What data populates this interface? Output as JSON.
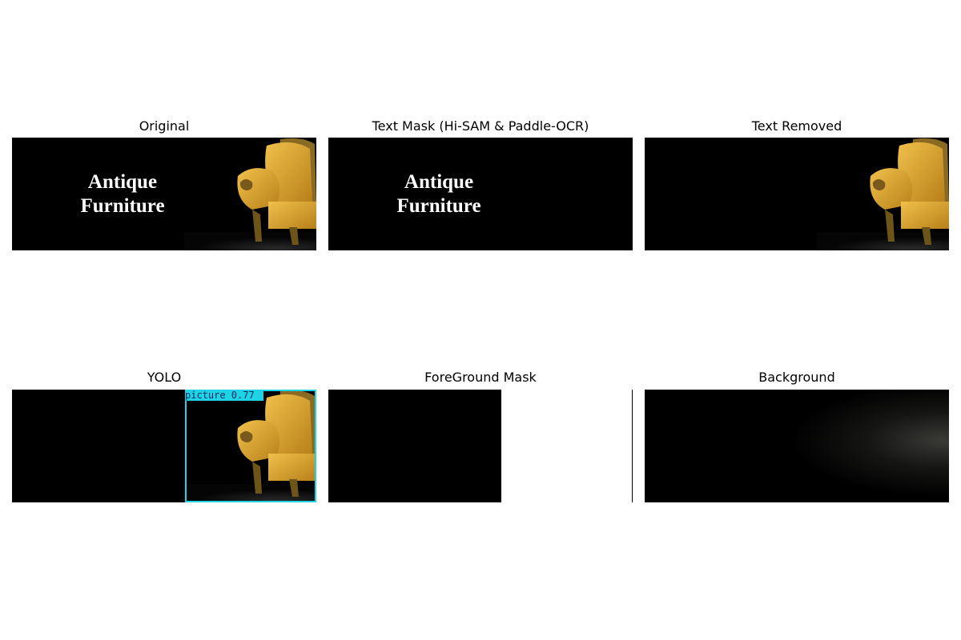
{
  "panels": [
    {
      "title": "Original",
      "caption": "Antique\nFurniture",
      "line1": "Antique",
      "line2": "Furniture"
    },
    {
      "title": "Text Mask (Hi-SAM & Paddle-OCR)",
      "line1": "Antique",
      "line2": "Furniture"
    },
    {
      "title": "Text Removed"
    },
    {
      "title": "YOLO",
      "detection_label": "picture  0.77",
      "box_color": "#1fd3e6"
    },
    {
      "title": "ForeGround Mask"
    },
    {
      "title": "Background"
    }
  ],
  "image_description_colors": {
    "chair_fabric": "#e3a82b",
    "chair_frame": "#8a6a23",
    "background": "#000000"
  }
}
